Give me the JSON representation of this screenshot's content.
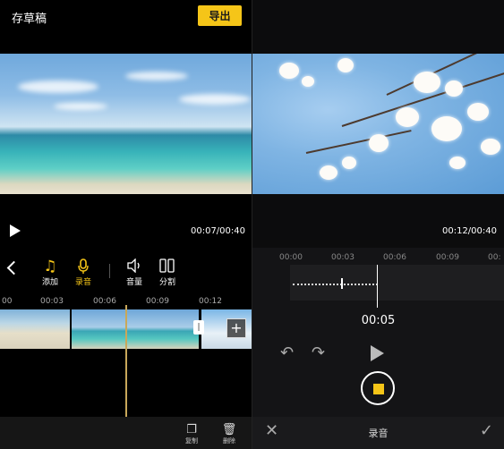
{
  "left": {
    "title": "存草稿",
    "export_label": "导出",
    "time": "00:07/00:40",
    "tools": [
      {
        "label": "添加",
        "icon": "music-note-icon"
      },
      {
        "label": "录音",
        "icon": "microphone-icon"
      },
      {
        "label": "音量",
        "icon": "speaker-icon"
      },
      {
        "label": "分割",
        "icon": "split-icon"
      }
    ],
    "ruler": [
      "00",
      "00:03",
      "00:06",
      "00:09",
      "00:12"
    ],
    "bottom_tools": [
      {
        "label": "复制",
        "icon": "copy-icon"
      },
      {
        "label": "删除",
        "icon": "trash-icon"
      }
    ]
  },
  "right": {
    "time": "00:12/00:40",
    "ruler": [
      "00:00",
      "00:03",
      "00:06",
      "00:09",
      "00:"
    ],
    "record_time": "00:05",
    "bottom_title": "录音"
  },
  "colors": {
    "accent": "#f5c518"
  }
}
